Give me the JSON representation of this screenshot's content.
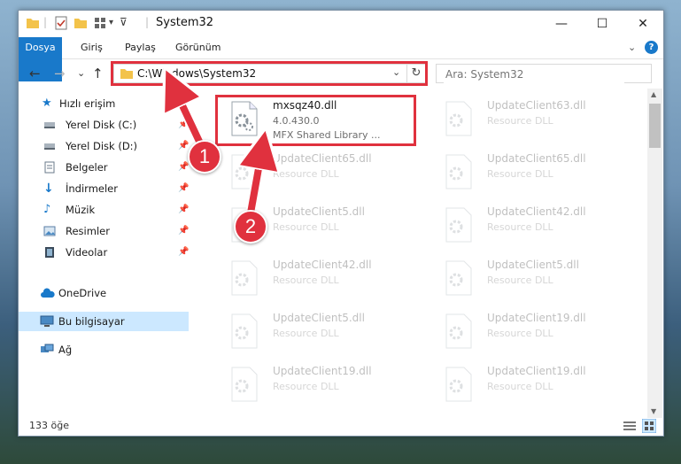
{
  "window": {
    "title": "System32",
    "controls": {
      "minimize": "—",
      "maximize": "☐",
      "close": "✕"
    }
  },
  "ribbon": {
    "tabs": [
      "Dosya",
      "Giriş",
      "Paylaş",
      "Görünüm"
    ],
    "collapse_glyph": "⌄",
    "help_glyph": "?"
  },
  "address": {
    "path": "C:\\Windows\\System32",
    "search_placeholder": "Ara: System32",
    "back": "←",
    "forward": "→",
    "recent": "⌄",
    "up": "↑",
    "dropdown": "⌄",
    "refresh": "↻"
  },
  "nav": {
    "quick_access": "Hızlı erişim",
    "items": [
      "Yerel Disk (C:)",
      "Yerel Disk (D:)",
      "Belgeler",
      "İndirmeler",
      "Müzik",
      "Resimler",
      "Videolar"
    ],
    "onedrive": "OneDrive",
    "this_pc": "Bu bilgisayar",
    "network": "Ağ"
  },
  "files": {
    "highlighted": {
      "name": "mxsqz40.dll",
      "version": "4.0.430.0",
      "desc": "MFX Shared Library ..."
    },
    "others": [
      {
        "name": "UpdateClient63.dll",
        "type": "Resource DLL"
      },
      {
        "name": "UpdateClient65.dll",
        "type": "Resource DLL"
      },
      {
        "name": "UpdateClient65.dll",
        "type": "Resource DLL"
      },
      {
        "name": "UpdateClient5.dll",
        "type": "Resource DLL"
      },
      {
        "name": "UpdateClient42.dll",
        "type": "Resource DLL"
      },
      {
        "name": "UpdateClient42.dll",
        "type": "Resource DLL"
      },
      {
        "name": "UpdateClient5.dll",
        "type": "Resource DLL"
      },
      {
        "name": "UpdateClient5.dll",
        "type": "Resource DLL"
      },
      {
        "name": "UpdateClient19.dll",
        "type": "Resource DLL"
      },
      {
        "name": "UpdateClient19.dll",
        "type": "Resource DLL"
      },
      {
        "name": "UpdateClient19.dll",
        "type": "Resource DLL"
      }
    ]
  },
  "status": {
    "count": "133 öğe"
  },
  "annotations": {
    "step1": "1",
    "step2": "2"
  },
  "colors": {
    "accent": "#1979ca",
    "highlight": "#e0313e",
    "selection": "#cce8ff"
  }
}
